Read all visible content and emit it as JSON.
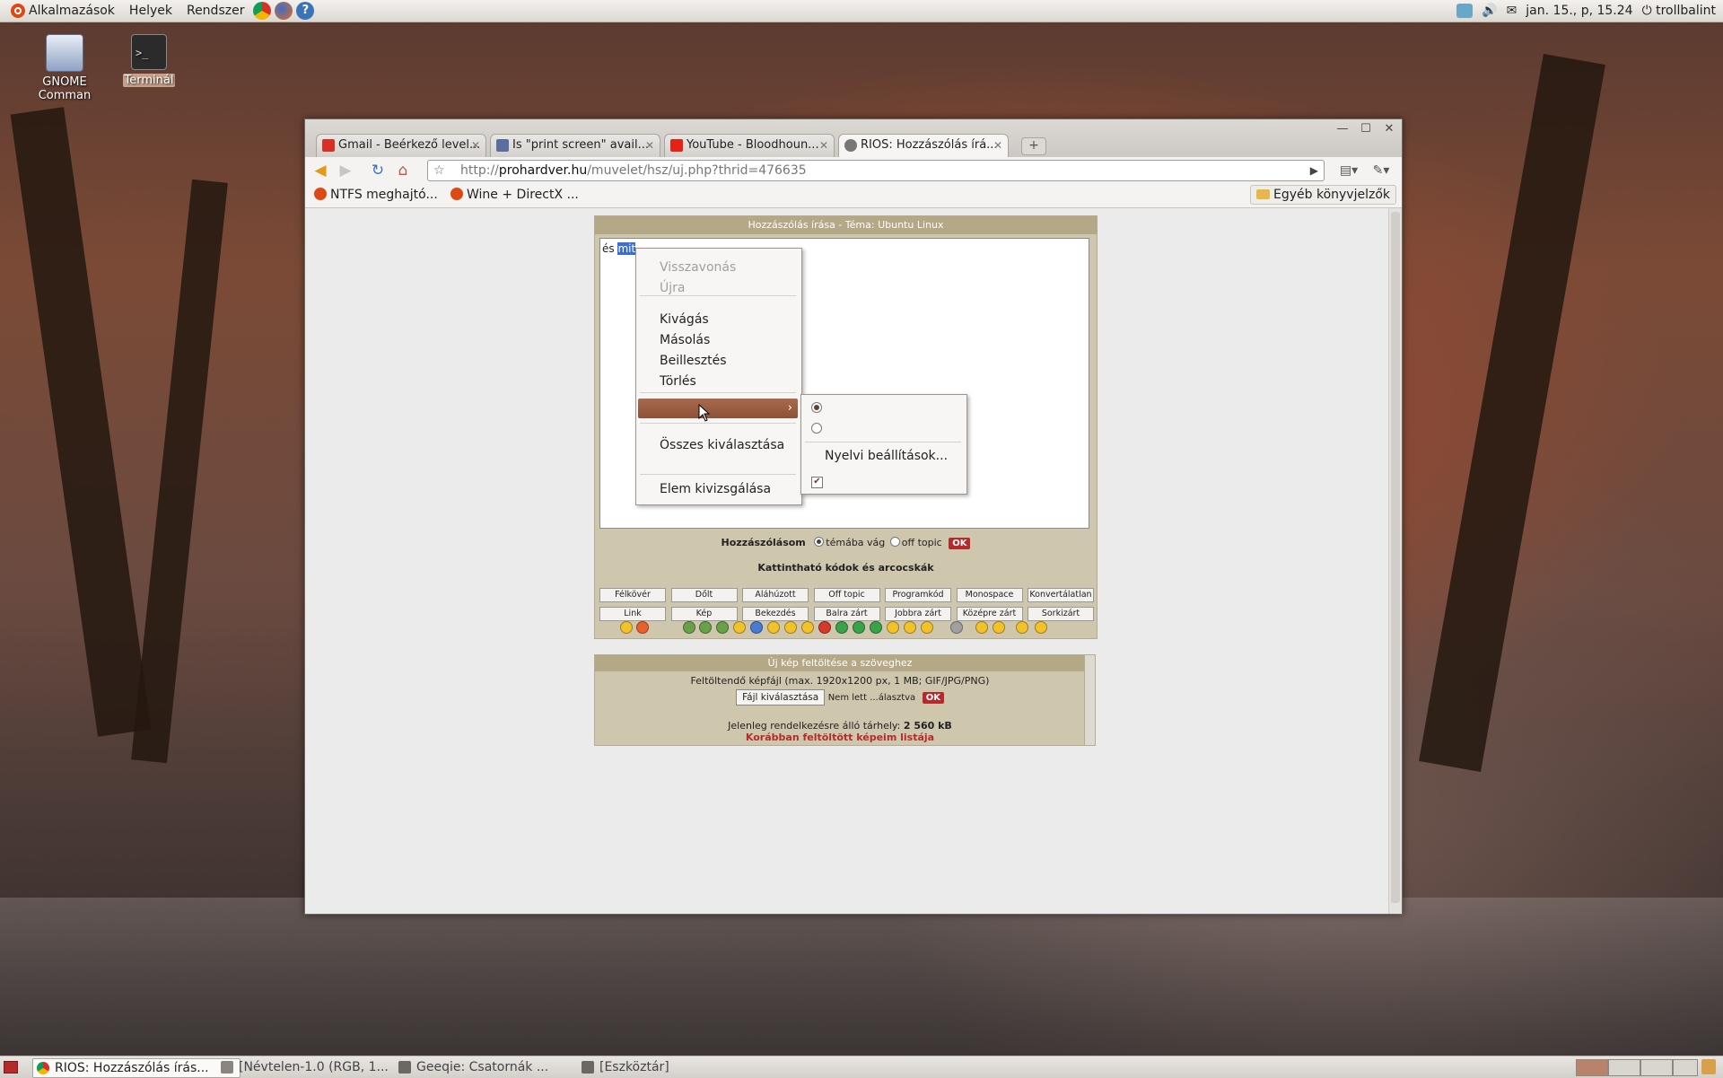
{
  "top_panel": {
    "menus": [
      "Alkalmazások",
      "Helyek",
      "Rendszer"
    ],
    "launchers": [
      "chrome-icon",
      "firefox-icon",
      "help-icon"
    ],
    "clock": "jan. 15., p, 15.24",
    "user": "trollbalint"
  },
  "desktop": {
    "icons": [
      {
        "label": "GNOME Comman"
      },
      {
        "label": "Terminál"
      }
    ]
  },
  "browser": {
    "tabs": [
      {
        "title": "Gmail - Beérkező level...",
        "favicon_color": "#d93025"
      },
      {
        "title": "Is \"print screen\" avail...",
        "favicon_color": "#5a6fa0"
      },
      {
        "title": "YouTube - Bloodhoun...",
        "favicon_color": "#e62117"
      },
      {
        "title": "RIOS: Hozzászólás írá...",
        "favicon_color": "#777777"
      }
    ],
    "url_prefix": "http://",
    "url_host": "prohardver.hu",
    "url_path": "/muvelet/hsz/uj.php?thrid=476635",
    "bookmarks": [
      "NTFS meghajtó...",
      "Wine + DirectX ..."
    ],
    "other_bookmarks": "Egyéb könyvjelzők"
  },
  "page": {
    "form_title": "Hozzászólás írása - Téma: Ubuntu Linux",
    "text_plain": "és ",
    "text_selected": "mit",
    "post_label": "Hozzászólásom",
    "option_on_topic": "témába vág",
    "option_off_topic": "off topic",
    "ok": "OK",
    "codes_title": "Kattintható kódok és arcocskák",
    "code_buttons_row1": [
      "Félkövér",
      "Dőlt",
      "Aláhúzott",
      "Off topic",
      "Programkód",
      "Monospace",
      "Konvertálatlan"
    ],
    "code_buttons_row2": [
      "Link",
      "Kép",
      "Bekezdés",
      "Balra zárt",
      "Jobbra zárt",
      "Középre zárt",
      "Sorkizárt"
    ],
    "upload_title": "Új kép feltöltése a szöveghez",
    "upload_info": "Feltöltendő képfájl (max. 1920x1200 px, 1 MB; GIF/JPG/PNG)",
    "file_button": "Fájl kiválasztása",
    "file_status": "Nem lett ...álasztva",
    "storage_label": "Jelenleg rendelkezésre álló tárhely:",
    "storage_value": "2 560 kB",
    "previous_images": "Korábban feltöltött képeim listája"
  },
  "context_menu": {
    "undo": "Visszavonás",
    "redo": "Újra",
    "cut": "Kivágás",
    "copy": "Másolás",
    "paste": "Beillesztés",
    "delete": "Törlés",
    "select_all": "Összes kiválasztása",
    "inspect": "Elem kivizsgálása",
    "submenu": {
      "language_settings": "Nyelvi beállítások..."
    }
  },
  "taskbar": {
    "tasks": [
      {
        "label": "RIOS: Hozzászólás írás...",
        "active": true
      },
      {
        "label": "[Névtelen-1.0 (RGB, 1...",
        "active": false
      },
      {
        "label": "Geeqie: Csatornák ...",
        "active": false
      },
      {
        "label": "[Eszköztár]",
        "active": false
      }
    ]
  }
}
